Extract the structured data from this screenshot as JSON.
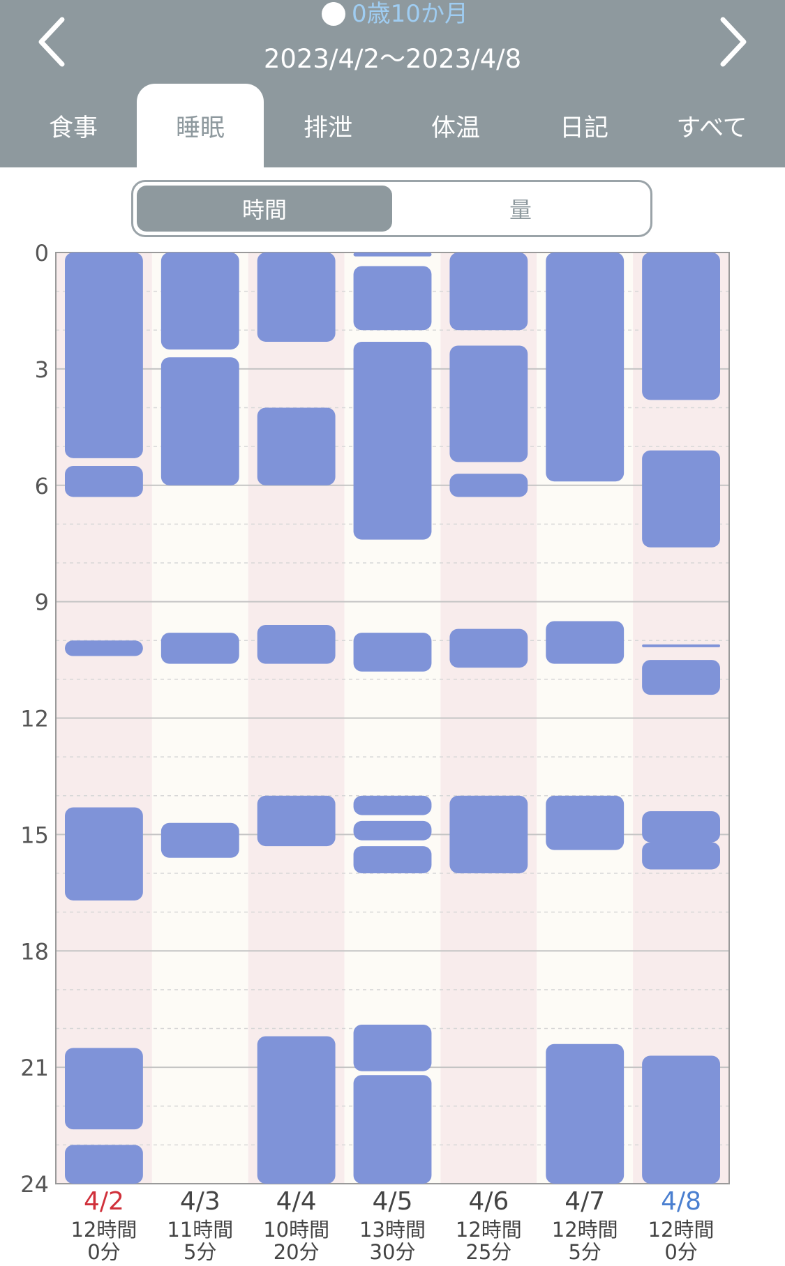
{
  "header": {
    "age": "0歳10か月",
    "date_range": "2023/4/2〜2023/4/8",
    "prev_icon": "chevron-left-icon",
    "next_icon": "chevron-right-icon",
    "baby_icon": "baby-icon"
  },
  "tabs": [
    {
      "label": "食事",
      "active": false
    },
    {
      "label": "睡眠",
      "active": true
    },
    {
      "label": "排泄",
      "active": false
    },
    {
      "label": "体温",
      "active": false
    },
    {
      "label": "日記",
      "active": false
    },
    {
      "label": "すべて",
      "active": false
    }
  ],
  "segment": {
    "time": "時間",
    "amount": "量",
    "selected": "時間"
  },
  "colors": {
    "header_bg": "#8e999e",
    "bar": "#7f93d8",
    "column_pink": "#f8ecec",
    "column_cream": "#fdfbf6",
    "sunday": "#d0303a",
    "saturday": "#4a7fd0"
  },
  "chart_data": {
    "type": "bar",
    "orientation": "vertical-timeline",
    "y_axis_unit": "hour",
    "yticks": [
      "0",
      "3",
      "6",
      "9",
      "12",
      "15",
      "18",
      "21",
      "24"
    ],
    "ylim": [
      0,
      24
    ],
    "categories": [
      "4/2",
      "4/3",
      "4/4",
      "4/5",
      "4/6",
      "4/7",
      "4/8"
    ],
    "date_colors": [
      "#d0303a",
      "#444444",
      "#444444",
      "#444444",
      "#444444",
      "#444444",
      "#4a7fd0"
    ],
    "totals_hours": [
      "12時間",
      "11時間",
      "10時間",
      "13時間",
      "12時間",
      "12時間",
      "12時間"
    ],
    "totals_minutes": [
      "0分",
      "5分",
      "20分",
      "30分",
      "25分",
      "5分",
      "0分"
    ],
    "sleep_intervals": [
      [
        [
          0,
          5.3
        ],
        [
          5.5,
          6.3
        ],
        [
          10.0,
          10.4
        ],
        [
          14.3,
          16.7
        ],
        [
          20.5,
          22.6
        ],
        [
          23.0,
          24.0
        ]
      ],
      [
        [
          0,
          2.5
        ],
        [
          2.7,
          6.0
        ],
        [
          9.8,
          10.6
        ],
        [
          14.7,
          15.6
        ]
      ],
      [
        [
          0,
          2.3
        ],
        [
          4.0,
          6.0
        ],
        [
          9.6,
          10.6
        ],
        [
          14.0,
          15.3
        ],
        [
          20.2,
          24.0
        ]
      ],
      [
        [
          0,
          0.1
        ],
        [
          0.35,
          2.0
        ],
        [
          2.3,
          7.4
        ],
        [
          9.8,
          10.8
        ],
        [
          14.0,
          14.5
        ],
        [
          14.65,
          15.15
        ],
        [
          15.3,
          16.0
        ],
        [
          19.9,
          21.1
        ],
        [
          21.2,
          24.0
        ]
      ],
      [
        [
          0,
          2.0
        ],
        [
          2.4,
          5.4
        ],
        [
          5.7,
          6.3
        ],
        [
          9.7,
          10.7
        ],
        [
          14.0,
          16.0
        ]
      ],
      [
        [
          0,
          5.9
        ],
        [
          9.5,
          10.6
        ],
        [
          14.0,
          15.4
        ],
        [
          20.4,
          24.0
        ]
      ],
      [
        [
          0,
          3.8
        ],
        [
          5.1,
          7.6
        ],
        [
          10.1,
          10.15
        ],
        [
          10.5,
          11.4
        ],
        [
          14.4,
          15.2
        ],
        [
          15.2,
          15.9
        ],
        [
          20.7,
          24.0
        ]
      ]
    ],
    "grid": true
  }
}
